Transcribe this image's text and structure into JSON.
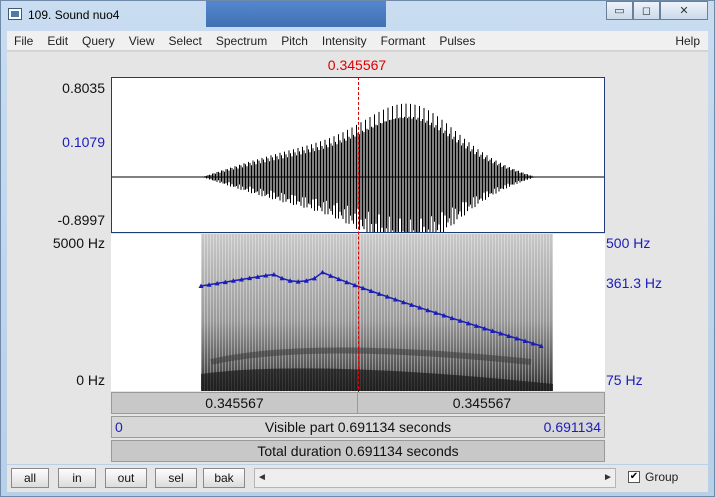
{
  "window": {
    "title": "109. Sound nuo4",
    "buttons": {
      "minimize": "▭",
      "maximize": "◻",
      "close": "✕"
    }
  },
  "menu": [
    "File",
    "Edit",
    "Query",
    "View",
    "Select",
    "Spectrum",
    "Pitch",
    "Intensity",
    "Formant",
    "Pulses"
  ],
  "menu_help": "Help",
  "cursor_time": "0.345567",
  "waveform": {
    "max": "0.8035",
    "cursor_value": "0.1079",
    "min": "-0.8997"
  },
  "spectrogram": {
    "freq_max": "5000 Hz",
    "freq_min": "0 Hz"
  },
  "pitch": {
    "max": "500 Hz",
    "cursor": "361.3 Hz",
    "min": "75 Hz"
  },
  "time_bar": {
    "left": "0.345567",
    "right": "0.345567"
  },
  "visible_bar": {
    "start": "0",
    "text": "Visible part 0.691134 seconds",
    "end": "0.691134"
  },
  "total_bar": {
    "text": "Total duration 0.691134 seconds"
  },
  "zoom_buttons": [
    "all",
    "in",
    "out",
    "sel",
    "bak"
  ],
  "scroll": {
    "left": "◄",
    "right": "►"
  },
  "group": {
    "checked": "✔",
    "label": "Group"
  },
  "colors": {
    "cursor": "#dd0000",
    "pitch": "#1c1cbb",
    "frame": "#1e3a78"
  }
}
